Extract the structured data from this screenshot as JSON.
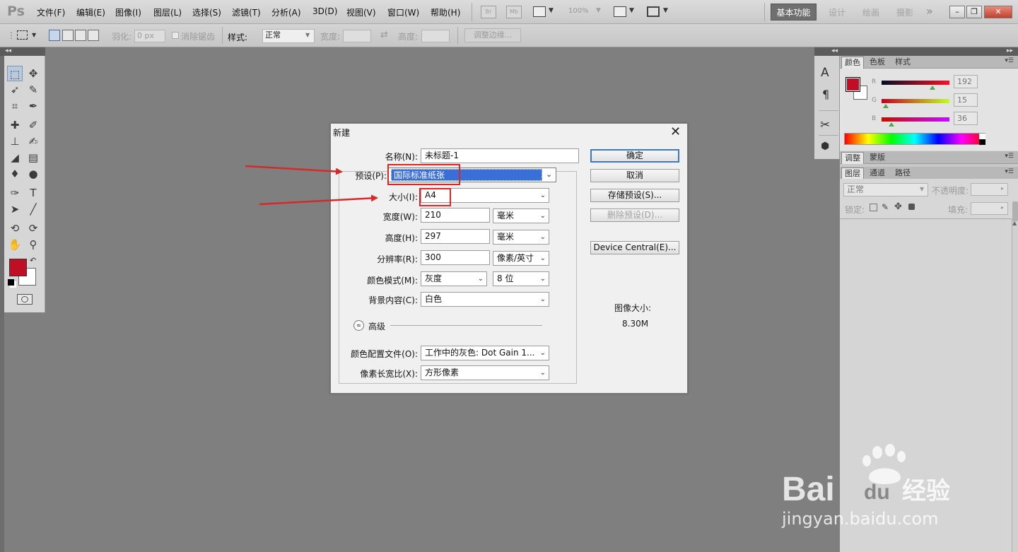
{
  "app": {
    "logo": "Ps"
  },
  "menubar": {
    "items": [
      "文件(F)",
      "编辑(E)",
      "图像(I)",
      "图层(L)",
      "选择(S)",
      "滤镜(T)",
      "分析(A)",
      "3D(D)",
      "视图(V)",
      "窗口(W)",
      "帮助(H)"
    ],
    "bridge": "Br",
    "minibridge": "Mb",
    "zoom": "100%",
    "workspaces": {
      "active": "基本功能",
      "others": [
        "设计",
        "绘画",
        "摄影"
      ]
    },
    "more": "»",
    "window_buttons": [
      "–",
      "❐",
      "✕"
    ]
  },
  "options": {
    "feather_label": "羽化:",
    "feather_value": "0 px",
    "antialias_label": "消除锯齿",
    "style_label": "样式:",
    "style_value": "正常",
    "width_label": "宽度:",
    "height_label": "高度:",
    "refine_button": "调整边缘..."
  },
  "right_panels": {
    "color_tabs": [
      "颜色",
      "色板",
      "样式"
    ],
    "r_label": "R",
    "g_label": "G",
    "b_label": "B",
    "r_value": "192",
    "g_value": "15",
    "b_value": "36",
    "r_fraction": 0.753,
    "g_fraction": 0.059,
    "b_fraction": 0.141,
    "adj_tabs": [
      "调整",
      "蒙版"
    ],
    "layer_tabs": [
      "图层",
      "通道",
      "路径"
    ],
    "blend_mode": "正常",
    "opacity_label": "不透明度:",
    "lock_label": "锁定:",
    "fill_label": "填充:",
    "foreground_color": "#c00f24"
  },
  "dialog": {
    "title": "新建",
    "close": "✕",
    "name_label": "名称(N):",
    "name_value": "未标题-1",
    "preset_label": "预设(P):",
    "preset_value": "国际标准纸张",
    "size_label": "大小(I):",
    "size_value": "A4",
    "width_label": "宽度(W):",
    "width_value": "210",
    "width_unit": "毫米",
    "height_label": "高度(H):",
    "height_value": "297",
    "height_unit": "毫米",
    "resolution_label": "分辨率(R):",
    "resolution_value": "300",
    "resolution_unit": "像素/英寸",
    "colormode_label": "颜色模式(M):",
    "colormode_value": "灰度",
    "bitdepth_value": "8 位",
    "background_label": "背景内容(C):",
    "background_value": "白色",
    "advanced_label": "高级",
    "advanced_icon": "≈",
    "profile_label": "颜色配置文件(O):",
    "profile_value": "工作中的灰色: Dot Gain 1...",
    "aspect_label": "像素长宽比(X):",
    "aspect_value": "方形像素",
    "ok": "确定",
    "cancel": "取消",
    "save_preset": "存储预设(S)...",
    "delete_preset": "删除预设(D)...",
    "device_central": "Device Central(E)...",
    "image_size_label": "图像大小:",
    "image_size_value": "8.30M"
  },
  "watermark": {
    "brand": "Bai du 经验",
    "url": "jingyan.baidu.com"
  },
  "colors": {
    "accent_red": "#d32a2a",
    "selection_blue": "#3a6fd8"
  }
}
